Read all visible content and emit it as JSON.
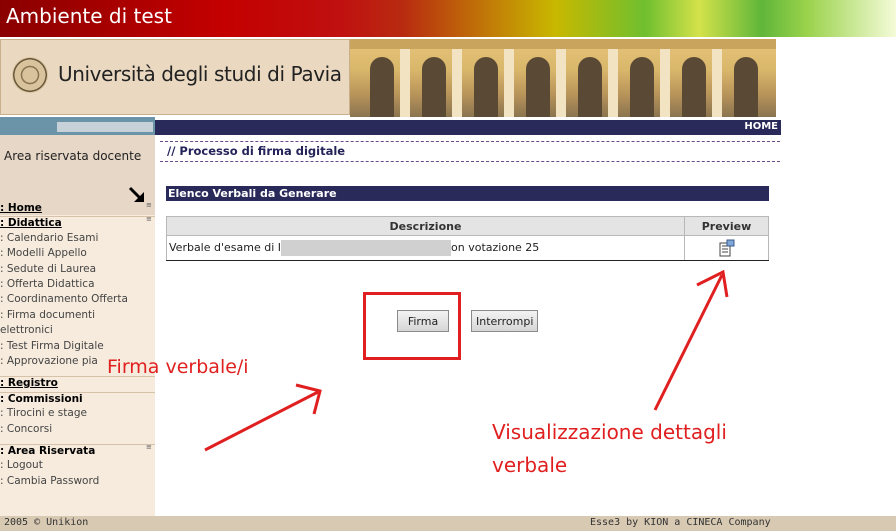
{
  "env_banner": "Ambiente di test",
  "university_name": "Università degli studi di Pavia",
  "sidebar": {
    "area_label": "Area riservata docente",
    "items": [
      {
        "label": ": Home"
      },
      {
        "label": ": Didattica"
      },
      {
        "label": ":  Calendario Esami"
      },
      {
        "label": ":  Modelli Appello"
      },
      {
        "label": ":  Sedute di Laurea"
      },
      {
        "label": ":  Offerta Didattica"
      },
      {
        "label": ":  Coordinamento Offerta"
      },
      {
        "label": ":  Firma documenti"
      },
      {
        "label": "elettronici"
      },
      {
        "label": ":  Test Firma Digitale"
      },
      {
        "label": ":  Approvazione pia"
      },
      {
        "label": ": Registro"
      },
      {
        "label": ": Commissioni"
      },
      {
        "label": ":  Tirocini e stage"
      },
      {
        "label": ":  Concorsi"
      },
      {
        "label": ": Area Riservata"
      },
      {
        "label": ":  Logout"
      },
      {
        "label": ":  Cambia Password"
      }
    ]
  },
  "topnav": {
    "home": "HOME"
  },
  "page_title": "// Processo di firma digitale",
  "section_title": "Elenco Verbali da Generare",
  "table": {
    "headers": [
      "Descrizione",
      "Preview"
    ],
    "rows": [
      {
        "desc_prefix": "Verbale d'esame di I",
        "desc_suffix": "on votazione 25",
        "preview_icon": "document-preview-icon"
      }
    ]
  },
  "buttons": {
    "firma": "Firma",
    "interrompi": "Interrompi"
  },
  "annotations": {
    "firma_label": "Firma verbale/i",
    "details_line1": "Visualizzazione dettagli",
    "details_line2": "verbale"
  },
  "footer": {
    "left": "2005 © Unikion",
    "right": "Esse3 by KION a CINECA Company"
  },
  "colors": {
    "annotation_red": "#e02020",
    "nav_bar": "#2a2a5a",
    "sidebar_bg": "#f6ebdd"
  }
}
